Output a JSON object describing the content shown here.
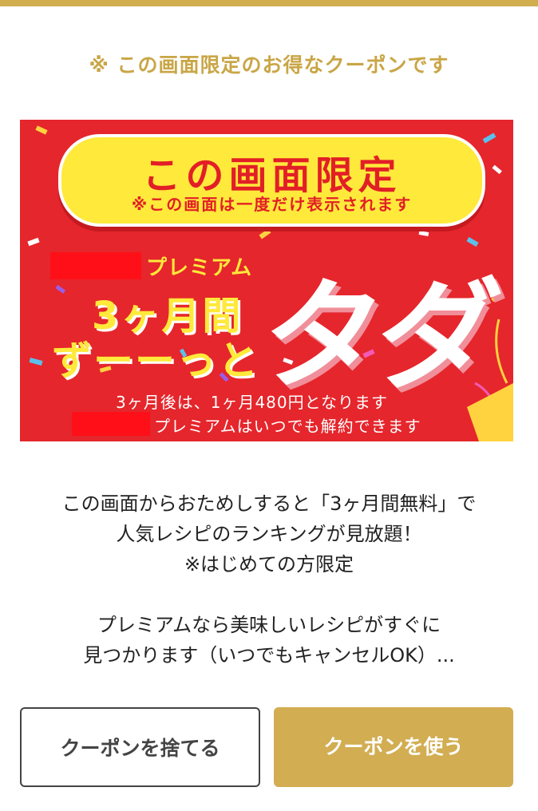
{
  "notice": "※ この画面限定のお得なクーポンです",
  "banner": {
    "title": "この画面限定",
    "subtitle": "※この画面は一度だけ表示されます",
    "premium_label": "プレミアム",
    "months_label": "3ヶ月間",
    "zutto_label": "ずーーっと",
    "tada_label": "タダ",
    "after_note": "3ヶ月後は、1ヶ月480円となります",
    "cancel_note": "プレミアムはいつでも解約できます"
  },
  "description": {
    "line1": "この画面からおためしすると「3ヶ月間無料」で",
    "line2": "人気レシピのランキングが見放題！",
    "line3": "※はじめての方限定",
    "line4": "プレミアムなら美味しいレシピがすぐに",
    "line5": "見つかります（いつでもキャンセルOK）..."
  },
  "buttons": {
    "discard": "クーポンを捨てる",
    "use": "クーポンを使う"
  },
  "colors": {
    "accent_gold": "#d1ad4e",
    "banner_red": "#e5262c",
    "banner_yellow": "#ffe93b"
  }
}
